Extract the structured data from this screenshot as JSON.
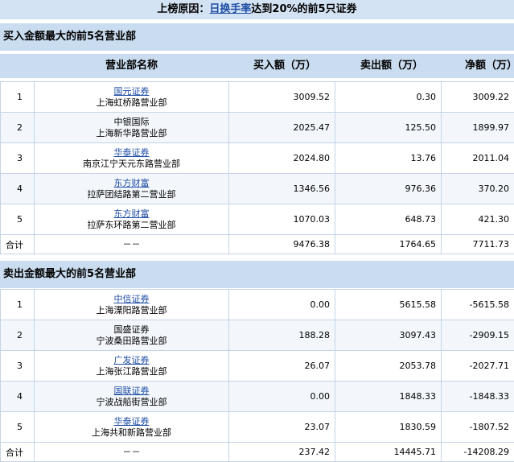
{
  "title": {
    "prefix": "上榜原因：",
    "link": "日换手率",
    "suffix": "达到20%的前5只证券"
  },
  "columns": {
    "name": "营业部名称",
    "buy": "买入额（万）",
    "sell": "卖出额（万）",
    "net": "净额（万）"
  },
  "buy_section": {
    "heading": "买入金额最大的前5名营业部",
    "rows": [
      {
        "idx": "1",
        "broker": "国元证券",
        "linked": true,
        "branch": "上海虹桥路营业部",
        "buy": "3009.52",
        "sell": "0.30",
        "net": "3009.22"
      },
      {
        "idx": "2",
        "broker": "中银国际",
        "linked": false,
        "branch": "上海新华路营业部",
        "buy": "2025.47",
        "sell": "125.50",
        "net": "1899.97"
      },
      {
        "idx": "3",
        "broker": "华泰证券",
        "linked": true,
        "branch": "南京江宁天元东路营业部",
        "buy": "2024.80",
        "sell": "13.76",
        "net": "2011.04"
      },
      {
        "idx": "4",
        "broker": "东方财富",
        "linked": true,
        "branch": "拉萨团结路第二营业部",
        "buy": "1346.56",
        "sell": "976.36",
        "net": "370.20"
      },
      {
        "idx": "5",
        "broker": "东方财富",
        "linked": true,
        "branch": "拉萨东环路第二营业部",
        "buy": "1070.03",
        "sell": "648.73",
        "net": "421.30"
      }
    ],
    "total": {
      "label": "合计",
      "name": "－－",
      "buy": "9476.38",
      "sell": "1764.65",
      "net": "7711.73"
    }
  },
  "sell_section": {
    "heading": "卖出金额最大的前5名营业部",
    "rows": [
      {
        "idx": "1",
        "broker": "中信证券",
        "linked": true,
        "branch": "上海溧阳路营业部",
        "buy": "0.00",
        "sell": "5615.58",
        "net": "-5615.58"
      },
      {
        "idx": "2",
        "broker": "国盛证券",
        "linked": false,
        "branch": "宁波桑田路营业部",
        "buy": "188.28",
        "sell": "3097.43",
        "net": "-2909.15"
      },
      {
        "idx": "3",
        "broker": "广发证券",
        "linked": true,
        "branch": "上海张江路营业部",
        "buy": "26.07",
        "sell": "2053.78",
        "net": "-2027.71"
      },
      {
        "idx": "4",
        "broker": "国联证券",
        "linked": true,
        "branch": "宁波战船街营业部",
        "buy": "0.00",
        "sell": "1848.33",
        "net": "-1848.33"
      },
      {
        "idx": "5",
        "broker": "华泰证券",
        "linked": true,
        "branch": "上海共和新路营业部",
        "buy": "23.07",
        "sell": "1830.59",
        "net": "-1807.52"
      }
    ],
    "total": {
      "label": "合计",
      "name": "－－",
      "buy": "237.42",
      "sell": "14445.71",
      "net": "-14208.29"
    }
  },
  "colors": {
    "header_bg": "#cadcef",
    "title_bg": "#d4e3f3",
    "link": "#1f4ea3",
    "border": "#c4d4e6"
  }
}
